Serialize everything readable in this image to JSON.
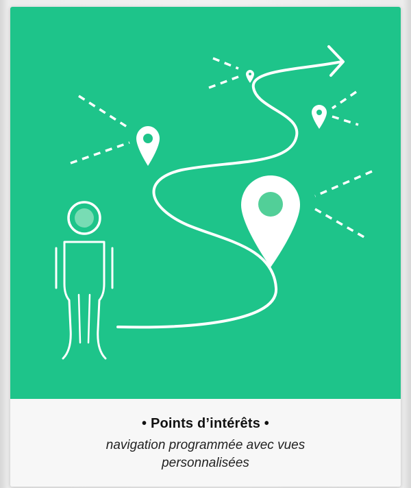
{
  "card": {
    "title": "• Points d’intérêts •",
    "subtitle": "navigation programmée avec vues personnalisées"
  },
  "colors": {
    "illustration_background": "#1ec48a",
    "line_color": "#ffffff",
    "caption_background": "#f7f7f7"
  },
  "icons": [
    "person-icon",
    "map-pin-icon",
    "route-arrow-icon"
  ]
}
